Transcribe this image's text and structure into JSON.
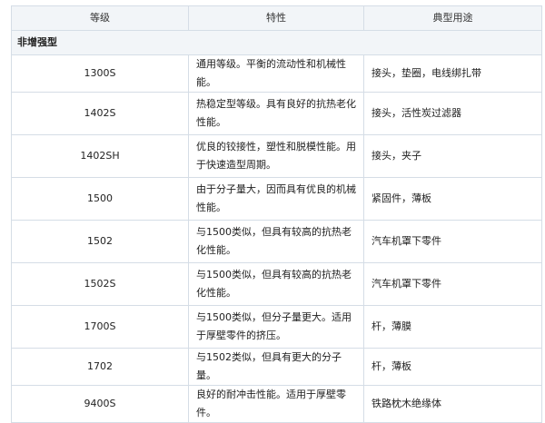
{
  "headers": [
    "等级",
    "特性",
    "典型用途"
  ],
  "section": "非增强型",
  "rows": [
    {
      "grade": "1300S",
      "prop": "通用等级。平衡的流动性和机械性能。",
      "use": "接头，垫圈，电线绑扎带"
    },
    {
      "grade": "1402S",
      "prop": "热稳定型等级。具有良好的抗热老化性能。",
      "use": "接头，活性炭过滤器"
    },
    {
      "grade": "1402SH",
      "prop": "优良的铰接性，塑性和脱模性能。用于快速造型周期。",
      "use": "接头，夹子"
    },
    {
      "grade": "1500",
      "prop": "由于分子量大，因而具有优良的机械性能。",
      "use": "紧固件，薄板"
    },
    {
      "grade": "1502",
      "prop": "与1500类似，但具有较高的抗热老化性能。",
      "use": "汽车机罩下零件"
    },
    {
      "grade": "1502S",
      "prop": "与1500类似，但具有较高的抗热老化性能。",
      "use": "汽车机罩下零件"
    },
    {
      "grade": "1700S",
      "prop": "与1500类似，但分子量更大。适用于厚壁零件的挤压。",
      "use": "杆，薄膜"
    },
    {
      "grade": "1702",
      "prop": "与1502类似，但具有更大的分子量。",
      "use": "杆，薄板"
    },
    {
      "grade": "9400S",
      "prop": "良好的耐冲击性能。适用于厚壁零件。",
      "use": "铁路枕木绝缘体"
    }
  ]
}
